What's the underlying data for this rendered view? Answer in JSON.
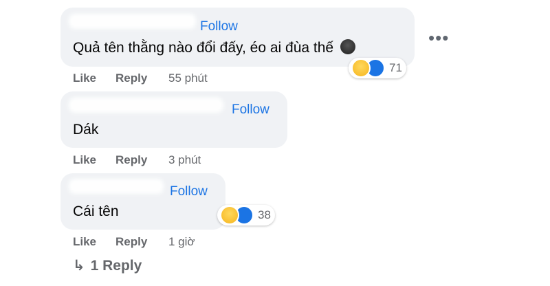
{
  "more_menu": {
    "glyph": "•••"
  },
  "comments": [
    {
      "follow": "Follow",
      "text": "Quả tên thằng nào đổi đấy, éo ai đùa thế",
      "inline_emoji": "face-emoji",
      "like": "Like",
      "reply": "Reply",
      "time": "55 phút",
      "reactions": {
        "count": "71",
        "types": [
          "haha",
          "like"
        ]
      }
    },
    {
      "follow": "Follow",
      "text": "Dák",
      "like": "Like",
      "reply": "Reply",
      "time": "3 phút"
    },
    {
      "follow": "Follow",
      "text": "Cái tên",
      "like": "Like",
      "reply": "Reply",
      "time": "1 giờ",
      "reactions": {
        "count": "38",
        "types": [
          "haha",
          "like"
        ]
      }
    }
  ],
  "replies_link": {
    "arrow": "↳",
    "label": "1 Reply"
  },
  "colors": {
    "accent": "#1b74e4",
    "bubble": "#f0f2f5",
    "muted": "#65676b"
  }
}
